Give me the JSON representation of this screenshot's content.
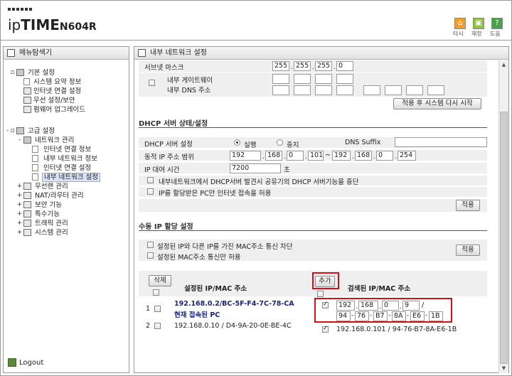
{
  "header": {
    "brand_prefix": "ip",
    "brand_bold": "TIME",
    "model": "N604R",
    "icons": [
      {
        "name": "home-icon",
        "label": "타시",
        "color": "#f0a02a"
      },
      {
        "name": "restart-icon",
        "label": "재장",
        "color": "#8cc43c"
      },
      {
        "name": "help-icon",
        "label": "도움",
        "glyph": "?",
        "color": "#46a34a"
      }
    ]
  },
  "sidebar": {
    "title": "메뉴탐색기",
    "basic": {
      "label": "기본 설정",
      "items": [
        "시스템 요약 정보",
        "인터넷 연결 설정",
        "무선 설정/보안",
        "펌웨어 업그레이드"
      ]
    },
    "advanced": {
      "label": "고급 설정",
      "network": {
        "label": "네트워크 관리",
        "items": [
          "인터넷 연결 정보",
          "내부 네트워크 정보",
          "인터넷 연결 설정",
          "내부 네트워크 설정"
        ]
      },
      "items": [
        "무선랜 관리",
        "NAT/라우터 관리",
        "보안 기능",
        "특수기능",
        "트래픽 관리",
        "시스템 관리"
      ]
    },
    "logout": "Logout"
  },
  "main": {
    "title": "내부 네트워크 설정",
    "top": {
      "subnet_label": "서브넷 마스크",
      "subnet": [
        "255",
        "255",
        "255",
        "0"
      ],
      "gateway_label": "내부 게이트웨이",
      "dns_label": "내부 DNS 주소",
      "apply_restart": "적용 후 시스템 다시 시작"
    },
    "dhcp": {
      "title": "DHCP 서버 상태/설정",
      "server_label": "DHCP 서버 설정",
      "run": "실행",
      "stop": "중지",
      "dns_suffix_label": "DNS Suffix",
      "dns_suffix": "",
      "range_label": "동적 IP 주소 범위",
      "range_start": [
        "192",
        "168",
        "0",
        "101"
      ],
      "range_end": [
        "192",
        "168",
        "0",
        "254"
      ],
      "tilde": "~",
      "lease_label": "IP 대여 시간",
      "lease": "7200",
      "lease_unit": "초",
      "opt1": "내부네트워크에서 DHCP서버 발견시 공유기의 DHCP 서버기능을 중단",
      "opt2": "IP를 할당받은 PC만 인터넷 접속을 허용",
      "apply": "적용"
    },
    "manual": {
      "title": "수동 IP 할당 설정",
      "opt1": "설정된 IP와 다른 IP를 가진 MAC주소 통신 차단",
      "opt2": "설정된 MAC주소 통신만 허용",
      "apply": "적용",
      "delete": "삭제",
      "add": "추가",
      "left_header": "설정된 IP/MAC 주소",
      "right_header": "검색된 IP/MAC 주소",
      "left_rows": [
        {
          "num": "1",
          "text": "192.168.0.2/BC-5F-F4-7C-78-CA",
          "sub": "현재 접속된 PC"
        },
        {
          "num": "2",
          "text": "192.168.0.10 / D4-9A-20-0E-BE-4C"
        }
      ],
      "new_ip": [
        "192",
        "168",
        "0",
        "9"
      ],
      "slash": "/",
      "new_mac": [
        "94",
        "76",
        "B7",
        "8A",
        "E6",
        "1B"
      ],
      "searched_row": "192.168.0.101 / 94-76-B7-8A-E6-1B"
    }
  }
}
